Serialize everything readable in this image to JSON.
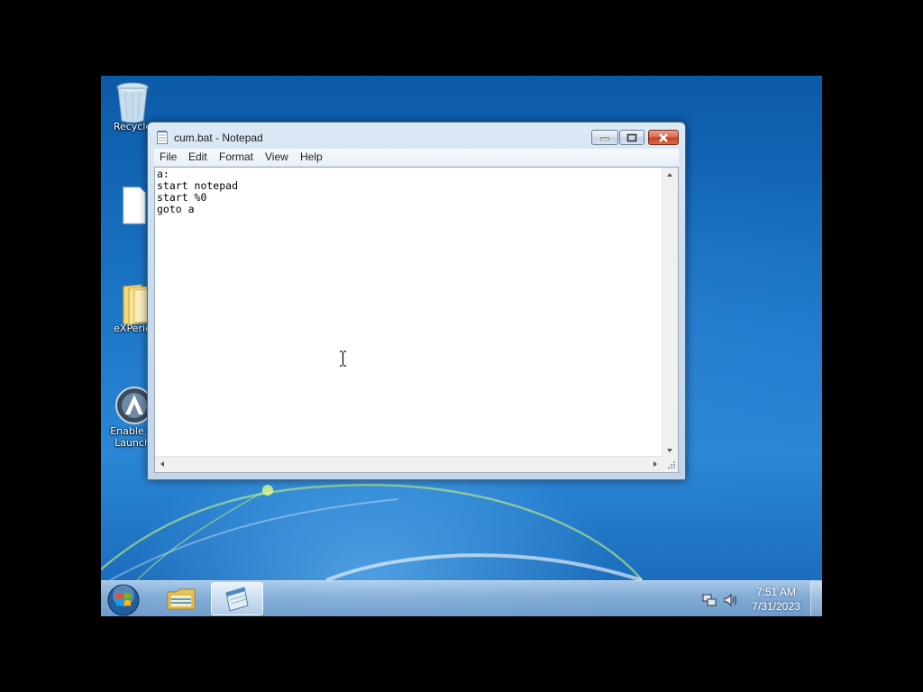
{
  "desktop": {
    "icons": [
      {
        "name": "recycle-bin",
        "label": "Recycle"
      },
      {
        "name": "file",
        "label": ""
      },
      {
        "name": "folder",
        "label": "eXPerie"
      },
      {
        "name": "launcher",
        "label": "Enable Q",
        "label2": "Launch"
      }
    ]
  },
  "window": {
    "title": "cum.bat - Notepad",
    "app_icon": "notepad-icon",
    "menu": [
      "File",
      "Edit",
      "Format",
      "View",
      "Help"
    ],
    "content": "a:\nstart notepad\nstart %0\ngoto a"
  },
  "taskbar": {
    "pinned": [
      {
        "name": "explorer",
        "icon": "folder-icon"
      },
      {
        "name": "notepad",
        "icon": "notepad-icon",
        "active": true
      }
    ],
    "clock_time": "7:51 AM",
    "clock_date": "7/31/2023"
  },
  "colors": {
    "desktop_blue": "#1d77c9",
    "close_red": "#c3401f",
    "taskbar": "#96b9dc"
  }
}
